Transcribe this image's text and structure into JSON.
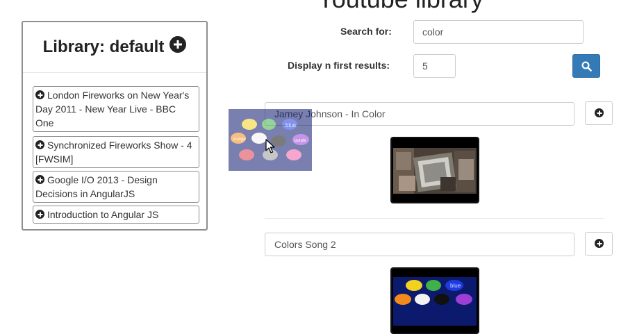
{
  "page": {
    "title": "Youtube library"
  },
  "library": {
    "title": "Library: default",
    "items": [
      {
        "label": "London Fireworks on New Year's Day 2011 - New Year Live - BBC One"
      },
      {
        "label": "Synchronized Fireworks Show - 4 [FWSIM]"
      },
      {
        "label": "Google I/O 2013 - Design Decisions in AngularJS"
      },
      {
        "label": "Introduction to Angular JS"
      }
    ]
  },
  "search": {
    "search_label": "Search for:",
    "search_value": "color",
    "count_label": "Display n first results:",
    "count_value": "5",
    "button_icon": "search-icon"
  },
  "results": [
    {
      "title": "Jamey Johnson - In Color",
      "add_icon": "plus-circle-icon"
    },
    {
      "title": "Colors Song 2",
      "add_icon": "plus-circle-icon"
    }
  ],
  "thumbnail_labels": {
    "blue": "blue",
    "orange": "orange",
    "purple": "purple"
  },
  "colors": {
    "accent": "#337ab7",
    "border": "#ccc",
    "panel_border": "#8e8e8e"
  }
}
